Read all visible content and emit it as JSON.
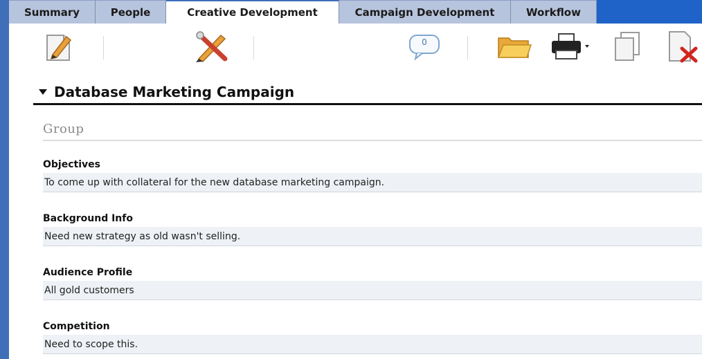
{
  "tabs": [
    {
      "label": "Summary",
      "active": false
    },
    {
      "label": "People",
      "active": false
    },
    {
      "label": "Creative Development",
      "active": true
    },
    {
      "label": "Campaign Development",
      "active": false
    },
    {
      "label": "Workflow",
      "active": false
    }
  ],
  "toolbar": {
    "comment_count": "0",
    "icons": [
      "edit-icon",
      "tools-icon",
      "comment-icon",
      "folder-icon",
      "print-icon",
      "copy-icon",
      "delete-icon"
    ]
  },
  "section": {
    "title": "Database Marketing Campaign"
  },
  "group": {
    "label": "Group"
  },
  "fields": [
    {
      "label": "Objectives",
      "value": "To come up with collateral for the new database marketing campaign."
    },
    {
      "label": "Background Info",
      "value": "Need new strategy as old wasn't selling."
    },
    {
      "label": "Audience Profile",
      "value": "All gold customers"
    },
    {
      "label": "Competition",
      "value": "Need to scope this."
    }
  ],
  "colors": {
    "tab_bg": "#b7c4dd",
    "accent_blue": "#1f63c9",
    "field_bg": "#eef1f5"
  }
}
